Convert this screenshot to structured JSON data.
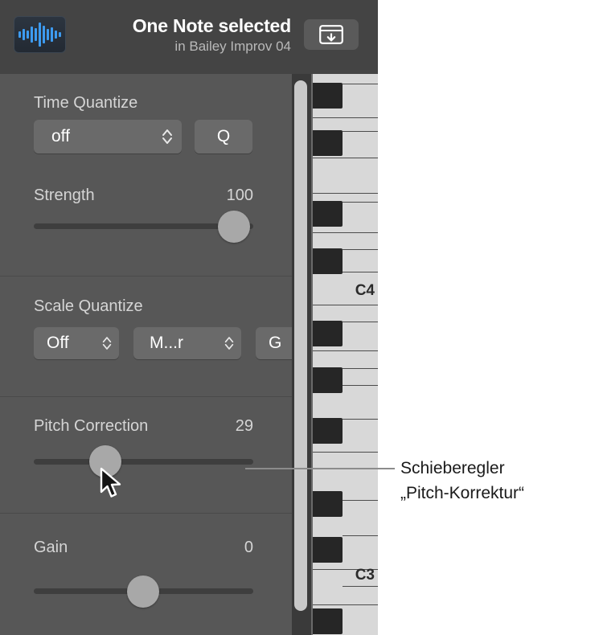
{
  "header": {
    "icon_name": "audio-waveform-icon",
    "title": "One Note selected",
    "subtitle": "in Bailey Improv 04",
    "button_icon_name": "window-download-icon"
  },
  "inspector": {
    "sections": [
      {
        "id": "time-quantize",
        "label": "Time Quantize",
        "popup_value": "off",
        "button_label": "Q",
        "param_label": "Strength",
        "param_value": "100",
        "param_percent": 100
      },
      {
        "id": "scale-quantize",
        "label": "Scale Quantize",
        "popups": [
          "Off",
          "M...r",
          "G"
        ]
      },
      {
        "id": "pitch-correction",
        "param_label": "Pitch Correction",
        "param_value": "29",
        "param_percent": 29
      },
      {
        "id": "gain",
        "param_label": "Gain",
        "param_value": "0",
        "param_percent": 50
      }
    ]
  },
  "keyboard": {
    "octave_labels": [
      "C4",
      "C3"
    ],
    "black_keys_y": [
      107,
      166,
      254,
      313,
      403,
      461,
      524,
      615,
      672,
      761
    ],
    "separators_y": [
      96,
      146,
      196,
      240,
      287,
      337,
      386,
      436,
      485,
      535,
      579,
      628,
      678,
      727,
      777
    ],
    "scrollbar_name": "vertical-scrollbar"
  },
  "callout": {
    "line1": "Schieberegler",
    "line2": "„Pitch-Korrektur“"
  },
  "colors": {
    "header_bg": "#444444",
    "panel_bg": "#575757",
    "control_bg": "#6a6a6a",
    "accent_blue": "#3d9bf0",
    "white_key": "#d8d8d8",
    "black_key": "#262626"
  }
}
